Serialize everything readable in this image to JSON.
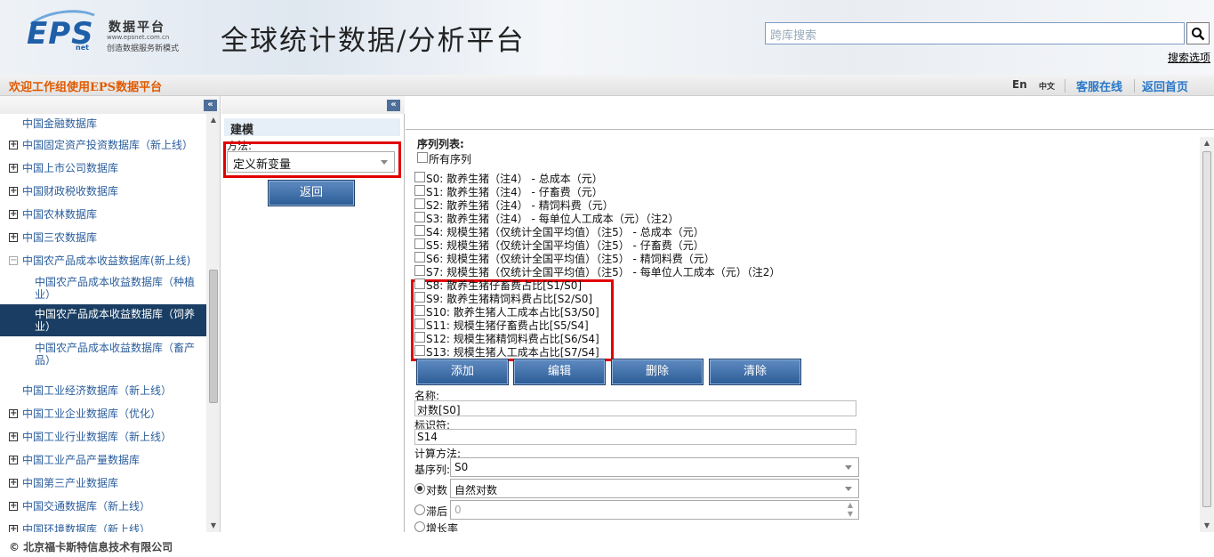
{
  "header": {
    "logo_text": "EPS",
    "logo_sub": "net",
    "brand_name": "数据平台",
    "brand_url": "www.epsnet.com.cn",
    "brand_slogan": "创造数据服务新模式",
    "site_title": "全球统计数据/分析平台",
    "search_placeholder": "跨库搜索",
    "search_icon": "search-icon",
    "advanced_search": "搜索选项"
  },
  "topbar": {
    "welcome": "欢迎工作组使用EPS数据平台",
    "lang_en": "En",
    "lang_zh": "中文",
    "service": "客服在线",
    "home": "返回首页"
  },
  "sidebar": {
    "collapse_icon": "double-chevron-left-icon",
    "items": [
      {
        "label": "中国金融数据库",
        "expand": false
      },
      {
        "label": "中国固定资产投资数据库（新上线）",
        "expand": true
      },
      {
        "label": "中国上市公司数据库",
        "expand": true
      },
      {
        "label": "中国财政税收数据库",
        "expand": true
      },
      {
        "label": "中国农林数据库",
        "expand": true
      },
      {
        "label": "中国三农数据库",
        "expand": true
      },
      {
        "label": "中国农产品成本收益数据库(新上线)",
        "expand": true
      },
      {
        "label": "中国农产品成本收益数据库（种植业）",
        "sub": true
      },
      {
        "label": "中国农产品成本收益数据库（饲养业）",
        "sub": true,
        "selected": true
      },
      {
        "label": "中国农产品成本收益数据库（畜产品）",
        "sub": true
      },
      {
        "label": "中国工业经济数据库（新上线）",
        "expand": false
      },
      {
        "label": "中国工业企业数据库（优化）",
        "expand": true
      },
      {
        "label": "中国工业行业数据库（新上线）",
        "expand": true
      },
      {
        "label": "中国工业产品产量数据库",
        "expand": true
      },
      {
        "label": "中国第三产业数据库",
        "expand": true
      },
      {
        "label": "中国交通数据库（新上线）",
        "expand": true
      },
      {
        "label": "中国环境数据库（新上线）",
        "expand": true
      }
    ]
  },
  "modeling": {
    "title": "建模",
    "method_label": "方法:",
    "method_value": "定义新变量",
    "back_button": "返回"
  },
  "series": {
    "title": "序列列表:",
    "all_label": "所有序列",
    "items": [
      "S0: 散养生猪（注4） - 总成本（元）",
      "S1: 散养生猪（注4） - 仔畜费（元）",
      "S2: 散养生猪（注4） - 精饲料费（元）",
      "S3: 散养生猪（注4） - 每单位人工成本（元）（注2）",
      "S4: 规模生猪（仅统计全国平均值）（注5） - 总成本（元）",
      "S5: 规模生猪（仅统计全国平均值）（注5） - 仔畜费（元）",
      "S6: 规模生猪（仅统计全国平均值）（注5） - 精饲料费（元）",
      "S7: 规模生猪（仅统计全国平均值）（注5） - 每单位人工成本（元）（注2）",
      "S8: 散养生猪仔畜费占比[S1/S0]",
      "S9: 散养生猪精饲料费占比[S2/S0]",
      "S10: 散养生猪人工成本占比[S3/S0]",
      "S11: 规模生猪仔畜费占比[S5/S4]",
      "S12: 规模生猪精饲料费占比[S6/S4]",
      "S13: 规模生猪人工成本占比[S7/S4]"
    ],
    "buttons": {
      "add": "添加",
      "edit": "编辑",
      "delete": "删除",
      "clear": "清除"
    }
  },
  "form": {
    "name_label": "名称:",
    "name_value": "对数[S0]",
    "id_label": "标识符:",
    "id_value": "S14",
    "calc_label": "计算方法:",
    "base_label": "基序列:",
    "base_value": "S0",
    "log_label": "对数",
    "log_value": "自然对数",
    "lag_label": "滞后",
    "lag_value": "0",
    "growth_label": "增长率"
  },
  "footer": {
    "copyright": "© 北京福卡斯特信息技术有限公司"
  },
  "colors": {
    "accent": "#2a78c8",
    "welcome": "#e05a00",
    "highlight": "#e10000",
    "selected": "#1a3e63",
    "button": "#2c5c96"
  }
}
